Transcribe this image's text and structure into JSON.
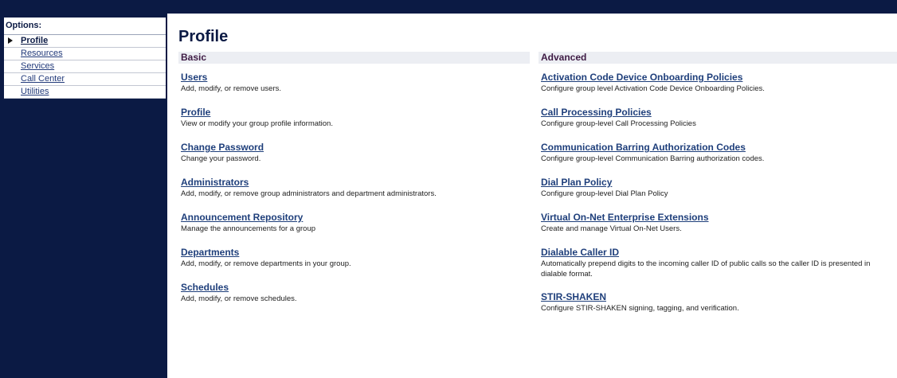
{
  "sidebar": {
    "title": "Options:",
    "items": [
      {
        "label": "Profile"
      },
      {
        "label": "Resources"
      },
      {
        "label": "Services"
      },
      {
        "label": "Call Center"
      },
      {
        "label": "Utilities"
      }
    ]
  },
  "main": {
    "title": "Profile",
    "basic": {
      "header": "Basic",
      "items": [
        {
          "title": "Users",
          "desc": "Add, modify, or remove users."
        },
        {
          "title": "Profile",
          "desc": "View or modify your group profile information."
        },
        {
          "title": "Change Password",
          "desc": "Change your password."
        },
        {
          "title": "Administrators",
          "desc": "Add, modify, or remove group administrators and department administrators."
        },
        {
          "title": "Announcement Repository",
          "desc": "Manage the announcements for a group"
        },
        {
          "title": "Departments",
          "desc": "Add, modify, or remove departments in your group."
        },
        {
          "title": "Schedules",
          "desc": "Add, modify, or remove schedules."
        }
      ]
    },
    "advanced": {
      "header": "Advanced",
      "items": [
        {
          "title": "Activation Code Device Onboarding Policies",
          "desc": "Configure group level Activation Code Device Onboarding Policies."
        },
        {
          "title": "Call Processing Policies",
          "desc": "Configure group-level Call Processing Policies"
        },
        {
          "title": "Communication Barring Authorization Codes",
          "desc": "Configure group-level Communication Barring authorization codes."
        },
        {
          "title": "Dial Plan Policy",
          "desc": "Configure group-level Dial Plan Policy"
        },
        {
          "title": "Virtual On-Net Enterprise Extensions",
          "desc": "Create and manage Virtual On-Net Users."
        },
        {
          "title": "Dialable Caller ID",
          "desc": "Automatically prepend digits to the incoming caller ID of public calls so the caller ID is presented in dialable format."
        },
        {
          "title": "STIR-SHAKEN",
          "desc": "Configure STIR-SHAKEN signing, tagging, and verification."
        }
      ]
    }
  },
  "colors": {
    "navy": "#0b1a44",
    "link": "#1f3f7b",
    "header_text": "#3e1b44",
    "header_bg": "#eceef3"
  }
}
